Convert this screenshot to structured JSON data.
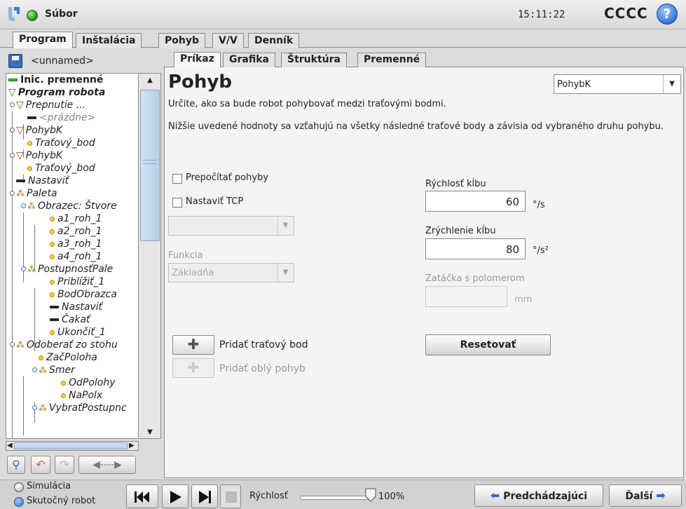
{
  "header": {
    "menu_file": "Súbor",
    "clock": "15:11:22",
    "robot_name": "CCCC",
    "help_glyph": "?"
  },
  "main_tabs": [
    {
      "label": "Program",
      "active": true
    },
    {
      "label": "Inštalácia",
      "active": false
    },
    {
      "label": "Pohyb",
      "active": false
    },
    {
      "label": "V/V",
      "active": false
    },
    {
      "label": "Denník",
      "active": false
    }
  ],
  "left": {
    "program_name": "<unnamed>",
    "tree": [
      {
        "label": "Inic. premenné"
      },
      {
        "label": "Program robota"
      },
      {
        "label": "Prepnutie ..."
      },
      {
        "label": "<prázdne>"
      },
      {
        "label": "PohybK"
      },
      {
        "label": "Traťový_bod"
      },
      {
        "label": "PohybK"
      },
      {
        "label": "Traťový_bod"
      },
      {
        "label": "Nastaviť"
      },
      {
        "label": "Paleta"
      },
      {
        "label": "Obrazec: Štvore"
      },
      {
        "label": "a1_roh_1"
      },
      {
        "label": "a2_roh_1"
      },
      {
        "label": "a3_roh_1"
      },
      {
        "label": "a4_roh_1"
      },
      {
        "label": "PostupnosťPale"
      },
      {
        "label": "Priblížiť_1"
      },
      {
        "label": "BodObrazca"
      },
      {
        "label": "Nastaviť"
      },
      {
        "label": "Čakať"
      },
      {
        "label": "Ukončiť_1"
      },
      {
        "label": "Odoberať zo stohu"
      },
      {
        "label": "ZačPoloha"
      },
      {
        "label": "Smer"
      },
      {
        "label": "OdPolohy"
      },
      {
        "label": "NaPolx"
      },
      {
        "label": "VybraťPostupnc"
      }
    ]
  },
  "sub_tabs": [
    {
      "label": "Príkaz",
      "active": true
    },
    {
      "label": "Grafika",
      "active": false
    },
    {
      "label": "Štruktúra",
      "active": false
    },
    {
      "label": "Premenné",
      "active": false
    }
  ],
  "command": {
    "title": "Pohyb",
    "mode_selected": "PohybK",
    "description1": "Určite, ako sa bude robot pohybovať medzi traťovými bodmi.",
    "description2": "Nižšie uvedené hodnoty sa vzťahujú na všetky následné traťové body a závisia od vybraného druhu pohybu.",
    "recalc_label": "Prepočítať pohyby",
    "set_tcp_label": "Nastaviť TCP",
    "function_label": "Funkcia",
    "function_value": "Základňa",
    "joint_speed_label": "Rýchlosť kĺbu",
    "joint_speed_value": "60",
    "joint_speed_unit": "°/s",
    "joint_accel_label": "Zrýchlenie kĺbu",
    "joint_accel_value": "80",
    "joint_accel_unit": "°/s²",
    "blend_label": "Zatáčka s polomerom",
    "blend_unit": "mm",
    "add_waypoint_label": "Pridať traťový bod",
    "add_circle_label": "Pridať oblý pohyb",
    "reset_label": "Resetovať"
  },
  "bottom": {
    "simulation_label": "Simulácia",
    "real_robot_label": "Skutočný robot",
    "speed_label": "Rýchlosť",
    "speed_value": "100%",
    "speed_fraction": 1.0,
    "prev_label": "Predchádzajúci",
    "next_label": "Ďalší"
  },
  "colors": {
    "accent_blue": "#2a6fd8",
    "status_green": "#2d9a20",
    "selection": "#c8d8f0"
  }
}
